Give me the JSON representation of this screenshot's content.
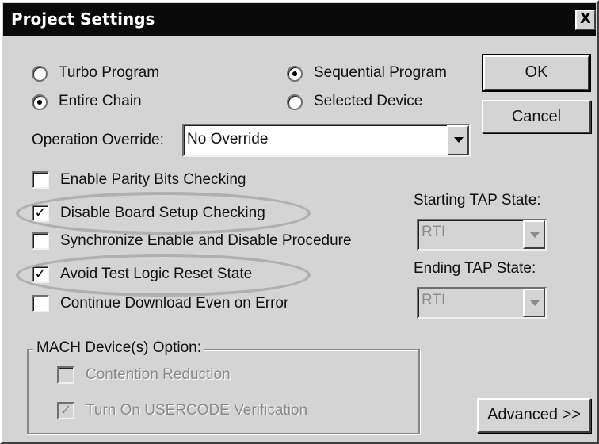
{
  "window": {
    "title": "Project Settings",
    "close_label": "X"
  },
  "program_mode": {
    "turbo_label": "Turbo Program",
    "sequential_label": "Sequential Program",
    "selected": "sequential"
  },
  "chain_scope": {
    "entire_label": "Entire Chain",
    "selected_device_label": "Selected Device",
    "selected": "entire"
  },
  "buttons": {
    "ok": "OK",
    "cancel": "Cancel",
    "advanced": "Advanced >>"
  },
  "operation_override": {
    "label": "Operation Override:",
    "value": "No Override"
  },
  "options": [
    {
      "label": "Enable Parity Bits Checking",
      "checked": false,
      "highlighted": false
    },
    {
      "label": "Disable Board Setup Checking",
      "checked": true,
      "highlighted": true
    },
    {
      "label": "Synchronize Enable and Disable Procedure",
      "checked": false,
      "highlighted": false
    },
    {
      "label": "Avoid Test Logic Reset State",
      "checked": true,
      "highlighted": true
    },
    {
      "label": "Continue Download Even on Error",
      "checked": false,
      "highlighted": false
    }
  ],
  "tap": {
    "starting_label": "Starting TAP State:",
    "starting_value": "RTI",
    "ending_label": "Ending TAP State:",
    "ending_value": "RTI",
    "enabled": false
  },
  "mach_group": {
    "title": "MACH Device(s) Option:",
    "contention_label": "Contention Reduction",
    "contention_checked": false,
    "usercode_label": "Turn On USERCODE Verification",
    "usercode_checked": true,
    "enabled": false
  },
  "colors": {
    "titlebar": "#0a0a0a",
    "face": "#d4d4d4",
    "highlight_ellipse": "#b0b0b0"
  }
}
